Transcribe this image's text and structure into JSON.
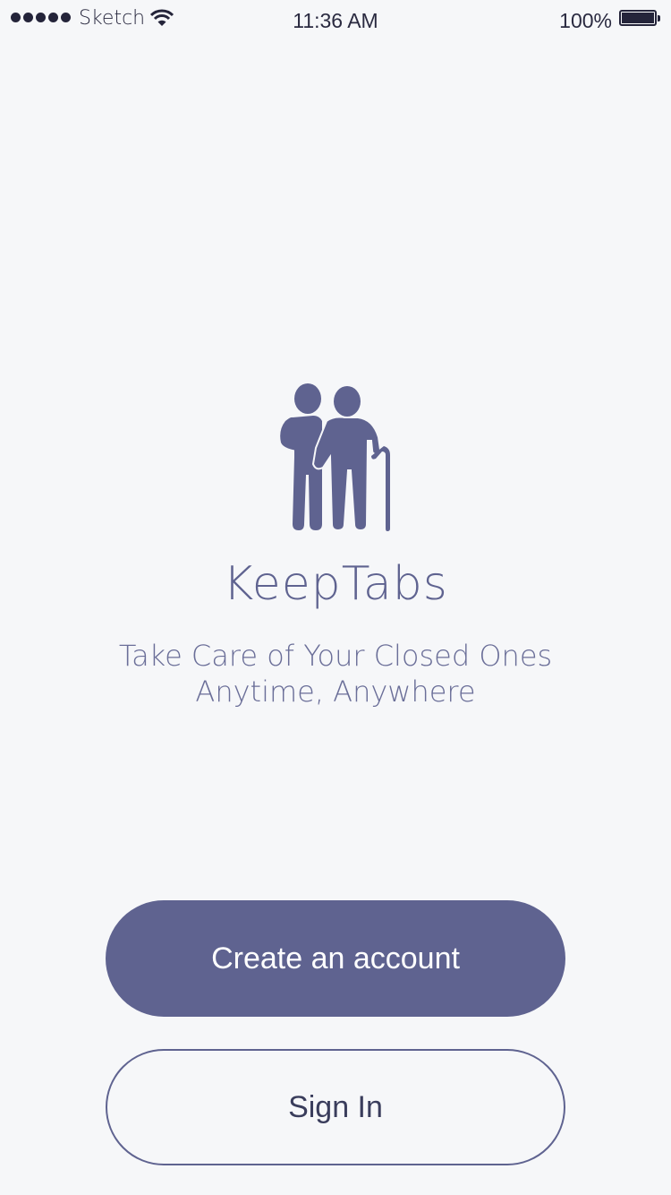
{
  "status_bar": {
    "carrier": "Sketch",
    "time": "11:36 AM",
    "battery": "100%",
    "signal_icon": "signal-dots-icon",
    "wifi_icon": "wifi-icon",
    "battery_icon": "battery-icon"
  },
  "app": {
    "title": "KeepTabs",
    "tagline_line1": "Take Care of Your Closed Ones",
    "tagline_line2": "Anytime, Anywhere",
    "logo_icon": "elderly-care-icon"
  },
  "actions": {
    "create_account": "Create an account",
    "sign_in": "Sign In"
  },
  "colors": {
    "accent": "#5f6390",
    "background": "#f6f7f9"
  }
}
